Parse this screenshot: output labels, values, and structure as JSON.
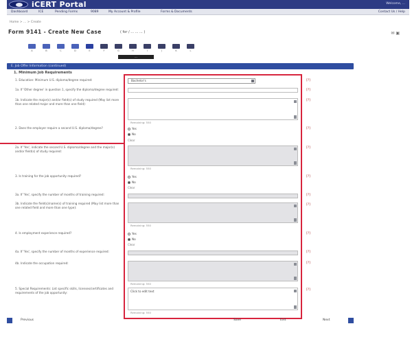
{
  "app": {
    "title": "iCERT Portal",
    "welcome": "Welcome, ...",
    "nav_right": "Contact Us / Help"
  },
  "nav": [
    "Dashboard",
    "ICE",
    "Pending Forms",
    "9089",
    "My Account & Profile",
    "Forms & Documents"
  ],
  "breadcrumb": "Home > ... > Create",
  "form": {
    "title": "Form 9141 - Create New Case",
    "subtitle": "( for / ... ... ... )",
    "icons": "✉ ▣"
  },
  "steps": [
    "A",
    "B",
    "C",
    "D",
    "E",
    "F",
    "G",
    "H",
    "I",
    "J",
    "K",
    "L"
  ],
  "step_tip": "...",
  "section": {
    "title": "E. Job Offer Information (continued)",
    "subheading": "1. Minimum Job Requirements"
  },
  "questions": [
    "1. Education: Minimum U.S. diploma/degree required:",
    "1a. If 'Other degree' in question 1, specify the diploma/degree required:",
    "1b. Indicate the major(s) and/or field(s) of study required (May list more than one related major and more than one field):",
    "2. Does the employer require a second U.S. diploma/degree?",
    "2a. If 'Yes', indicate the second U.S. diploma/degree and the major(s) and/or field(s) of study required:",
    "3. Is training for the job opportunity required?",
    "3a. If 'Yes', specify the number of months of training required:",
    "3b. Indicate the field(s)/name(s) of training required (May list more than one related field and more than one type):",
    "4. Is employment experience required?",
    "4a. If 'Yes', specify the number of months of experience required:",
    "4b. Indicate the occupation required:",
    "5. Special Requirements: List specific skills, licenses/certificates and requirements of the job opportunity:"
  ],
  "answers": {
    "education": "Bachelor's",
    "char_count_label": "Remaining: 550",
    "yes": "Yes",
    "no": "No",
    "clear": "Clear",
    "special_placeholder": "Click to edit text"
  },
  "help": "[?]",
  "bottom": {
    "previous": "Previous",
    "save": "Save",
    "next": "Next",
    "exit": "Exit",
    "faint": ""
  }
}
